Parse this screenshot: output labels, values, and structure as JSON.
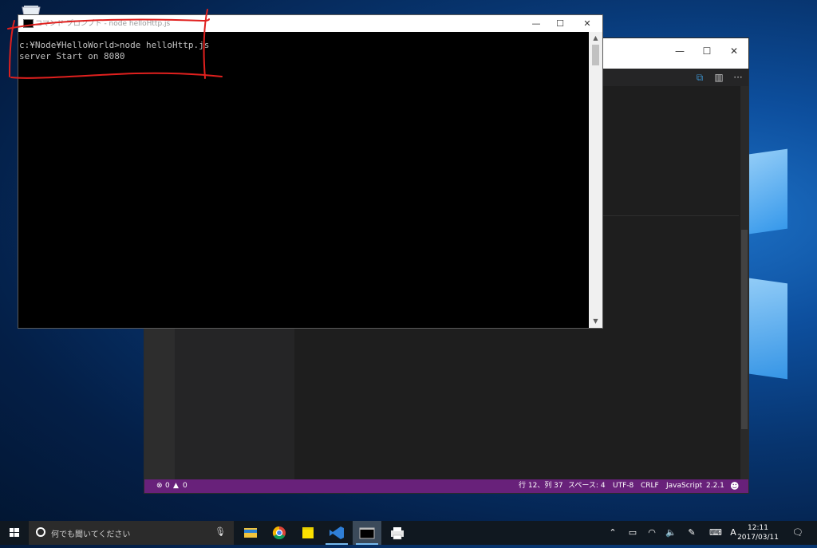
{
  "desktop": {
    "recycle_icon": "recycle-bin-icon"
  },
  "cmd": {
    "title": "コマンド プロンプト - node  helloHttp.js",
    "lines": [
      "c:¥Node¥HelloWorld>node helloHttp.js",
      "server Start on 8080"
    ],
    "controls": {
      "minimize": "—",
      "maximize": "☐",
      "close": "✕"
    }
  },
  "vscode": {
    "controls": {
      "minimize": "—",
      "maximize": "☐",
      "close": "✕"
    },
    "statusbar": {
      "errors": "0",
      "warnings": "0",
      "position": "行 12、列 37",
      "spaces": "スペース: 4",
      "encoding": "UTF-8",
      "eol": "CRLF",
      "language": "JavaScript",
      "version": "2.2.1"
    },
    "colors": {
      "statusbar": "#68217a"
    }
  },
  "taskbar": {
    "search_placeholder": "何でも聞いてください",
    "apps": [
      "file-explorer-icon",
      "chrome-icon",
      "sticky-notes-icon",
      "vscode-icon",
      "command-prompt-icon",
      "printer-icon"
    ],
    "tray": {
      "ime": "A"
    },
    "clock": {
      "time": "12:11",
      "date": "2017/03/11"
    }
  }
}
